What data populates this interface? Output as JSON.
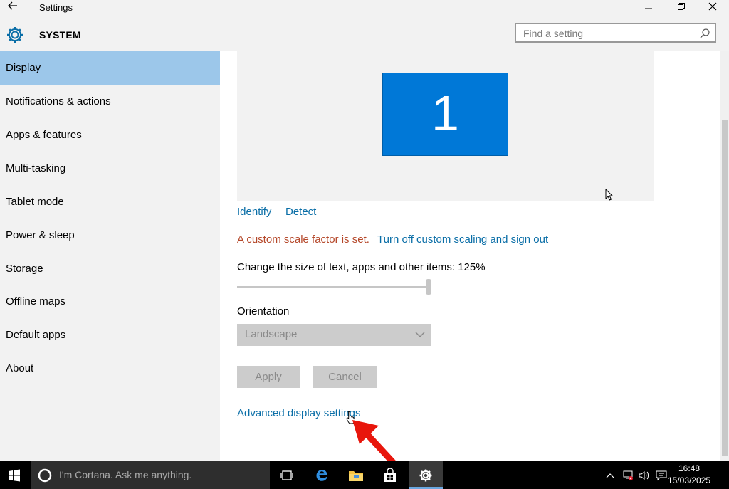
{
  "window": {
    "title": "Settings",
    "back_icon": "back-arrow-icon",
    "minimize_icon": "minimize-icon",
    "restore_icon": "restore-icon",
    "close_icon": "close-icon"
  },
  "header": {
    "section": "SYSTEM",
    "icon": "gear-icon",
    "search_placeholder": "Find a setting",
    "search_icon": "search-icon"
  },
  "sidebar": {
    "items": [
      {
        "label": "Display",
        "active": true
      },
      {
        "label": "Notifications & actions",
        "active": false
      },
      {
        "label": "Apps & features",
        "active": false
      },
      {
        "label": "Multi-tasking",
        "active": false
      },
      {
        "label": "Tablet mode",
        "active": false
      },
      {
        "label": "Power & sleep",
        "active": false
      },
      {
        "label": "Storage",
        "active": false
      },
      {
        "label": "Offline maps",
        "active": false
      },
      {
        "label": "Default apps",
        "active": false
      },
      {
        "label": "About",
        "active": false
      }
    ]
  },
  "display": {
    "monitor_number": "1",
    "identify": "Identify",
    "detect": "Detect",
    "custom_scale_msg": "A custom scale factor is set.",
    "turn_off_scaling": "Turn off custom scaling and sign out",
    "scale_label": "Change the size of text, apps and other items: 125%",
    "scale_slider_fraction": 1.0,
    "orientation_label": "Orientation",
    "orientation_value": "Landscape",
    "apply": "Apply",
    "cancel": "Cancel",
    "advanced": "Advanced display settings"
  },
  "taskbar": {
    "start_icon": "windows-start-icon",
    "cortana_placeholder": "I'm Cortana. Ask me anything.",
    "apps": [
      "task-view-icon",
      "edge-icon",
      "file-explorer-icon",
      "store-icon",
      "settings-icon"
    ],
    "tray": [
      "chevron-up-icon",
      "network-icon",
      "volume-icon",
      "action-center-icon"
    ],
    "time": "16:48",
    "date": "15/03/2025"
  },
  "colors": {
    "accent": "#0078d7",
    "selected_nav": "#9cc7ea",
    "link": "#0a6ea7",
    "warning": "#b5482a"
  }
}
